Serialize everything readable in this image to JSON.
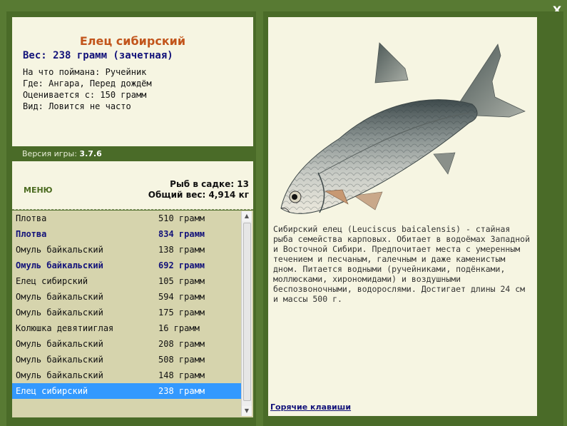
{
  "window": {
    "close_label": "X"
  },
  "fish_info": {
    "name": "Елец сибирский",
    "weight": "Вес: 238 грамм (зачетная)",
    "caught_on": "На что поймана: Ручейник",
    "location": "Где: Ангара, Перед дождём",
    "value": "Оценивается с: 150 грамм",
    "rarity": "Вид: Ловится не часто"
  },
  "version": {
    "label": "Версия игры:",
    "number": "3.7.6"
  },
  "menu_label": "МЕНЮ",
  "keepnet": {
    "count_label": "Рыб в садке: 13",
    "total_label": "Общий вес: 4,914 кг"
  },
  "catch_list": [
    {
      "name": "Плотва",
      "weight": "510 грамм",
      "style": "normal"
    },
    {
      "name": "Плотва",
      "weight": "834 грамм",
      "style": "bold"
    },
    {
      "name": "Омуль байкальский",
      "weight": "138 грамм",
      "style": "normal"
    },
    {
      "name": "Омуль байкальский",
      "weight": "692 грамм",
      "style": "bold"
    },
    {
      "name": "Елец сибирский",
      "weight": "105 грамм",
      "style": "normal"
    },
    {
      "name": "Омуль байкальский",
      "weight": "594 грамм",
      "style": "normal"
    },
    {
      "name": "Омуль байкальский",
      "weight": "175 грамм",
      "style": "normal"
    },
    {
      "name": "Колюшка девятииглая",
      "weight": "16 грамм",
      "style": "normal"
    },
    {
      "name": "Омуль байкальский",
      "weight": "208 грамм",
      "style": "normal"
    },
    {
      "name": "Омуль байкальский",
      "weight": "508 грамм",
      "style": "normal"
    },
    {
      "name": "Омуль байкальский",
      "weight": "148 грамм",
      "style": "normal"
    },
    {
      "name": "Елец сибирский",
      "weight": "238 грамм",
      "style": "selected"
    }
  ],
  "description": "Сибирский елец (Leuciscus baicalensis) - стайная рыба семейства карповых. Обитает в водоёмах Западной и Восточной Сибири. Предпочитает места с умеренным течением и песчаным, галечным и даже каменистым дном. Питается водными (ручейниками, подёнками, моллюсками, хирономидами) и воздушными беспозвоночными, водорослями. Достигает длины 24 см и массы 500 г.",
  "hotkeys_label": "Горячие клавиши",
  "colors": {
    "background": "#587a33",
    "panel": "#4a6b28",
    "card": "#f6f5e2",
    "list_bg": "#d6d4ad",
    "title": "#c2551c",
    "accent_text": "#13137a",
    "selection": "#3399ff"
  }
}
